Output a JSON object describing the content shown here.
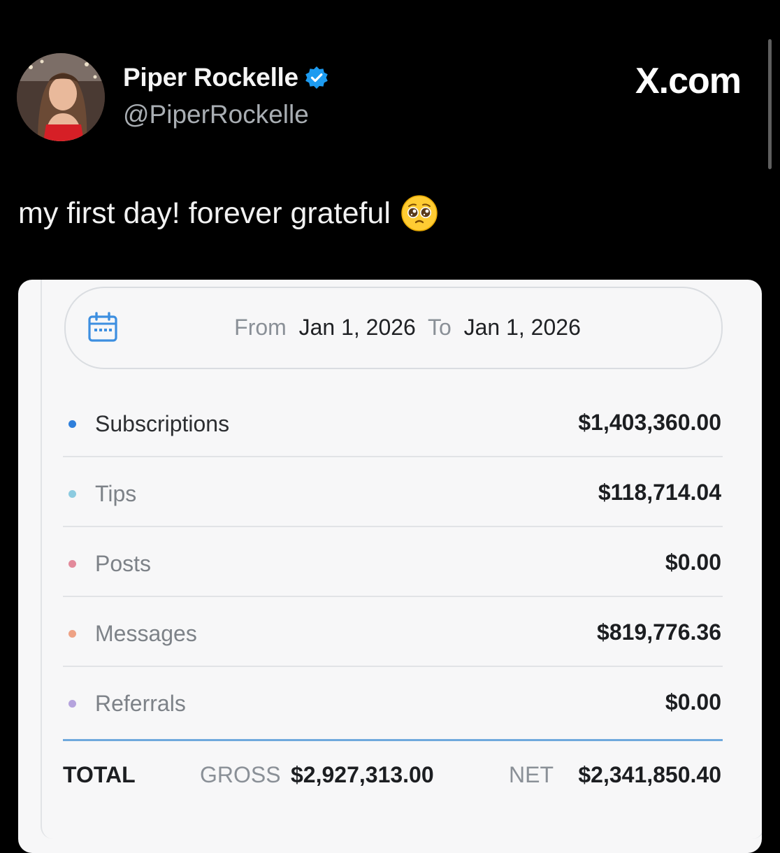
{
  "post": {
    "display_name": "Piper Rockelle",
    "handle": "@PiperRockelle",
    "site": "X.com",
    "text": "my first day! forever grateful",
    "emoji_icon": "pleading-face-emoji",
    "verified_color": "#1d9bf0"
  },
  "earnings": {
    "date_range": {
      "from_label": "From",
      "from_value": "Jan 1, 2026",
      "to_label": "To",
      "to_value": "Jan 1, 2026"
    },
    "rows": [
      {
        "label": "Subscriptions",
        "amount": "$1,403,360.00",
        "dot_color": "#2f7fdb"
      },
      {
        "label": "Tips",
        "amount": "$118,714.04",
        "dot_color": "#8ccbe0"
      },
      {
        "label": "Posts",
        "amount": "$0.00",
        "dot_color": "#e38a9b"
      },
      {
        "label": "Messages",
        "amount": "$819,776.36",
        "dot_color": "#eea285"
      },
      {
        "label": "Referrals",
        "amount": "$0.00",
        "dot_color": "#b5a3dd"
      }
    ],
    "total": {
      "label": "TOTAL",
      "gross_label": "GROSS",
      "gross_value": "$2,927,313.00",
      "net_label": "NET",
      "net_value": "$2,341,850.40"
    },
    "accent_color": "#6fa9dd"
  }
}
